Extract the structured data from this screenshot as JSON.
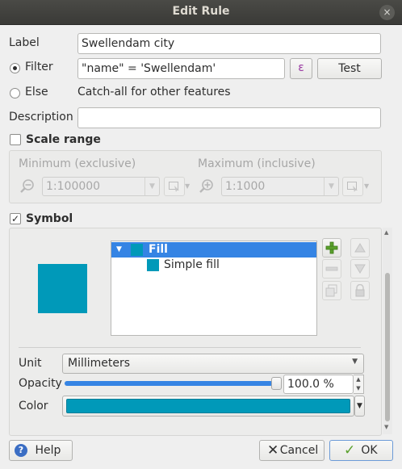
{
  "window": {
    "title": "Edit Rule",
    "close_icon": "×"
  },
  "label": {
    "caption": "Label",
    "value": "Swellendam city"
  },
  "filter": {
    "caption": "Filter",
    "selected": true,
    "value": "\"name\" = 'Swellendam'",
    "expression_button": "ε",
    "test_button": "Test"
  },
  "else": {
    "caption": "Else",
    "selected": false,
    "text": "Catch-all for other features"
  },
  "description": {
    "caption": "Description",
    "value": ""
  },
  "scale_range": {
    "caption": "Scale range",
    "checked": false,
    "minimum": {
      "caption": "Minimum (exclusive)",
      "value": "1:100000"
    },
    "maximum": {
      "caption": "Maximum (inclusive)",
      "value": "1:1000"
    }
  },
  "symbol": {
    "caption": "Symbol",
    "checked": true,
    "preview_color": "#0099b9",
    "layers": [
      {
        "label": "Fill",
        "selected": true
      },
      {
        "label": "Simple fill",
        "selected": false
      }
    ],
    "unit": {
      "caption": "Unit",
      "value": "Millimeters"
    },
    "opacity": {
      "caption": "Opacity",
      "value": "100.0 %",
      "level": 1.0
    },
    "color": {
      "caption": "Color",
      "value": "#0099b9"
    }
  },
  "buttons": {
    "help": "Help",
    "cancel": "Cancel",
    "ok": "OK"
  }
}
